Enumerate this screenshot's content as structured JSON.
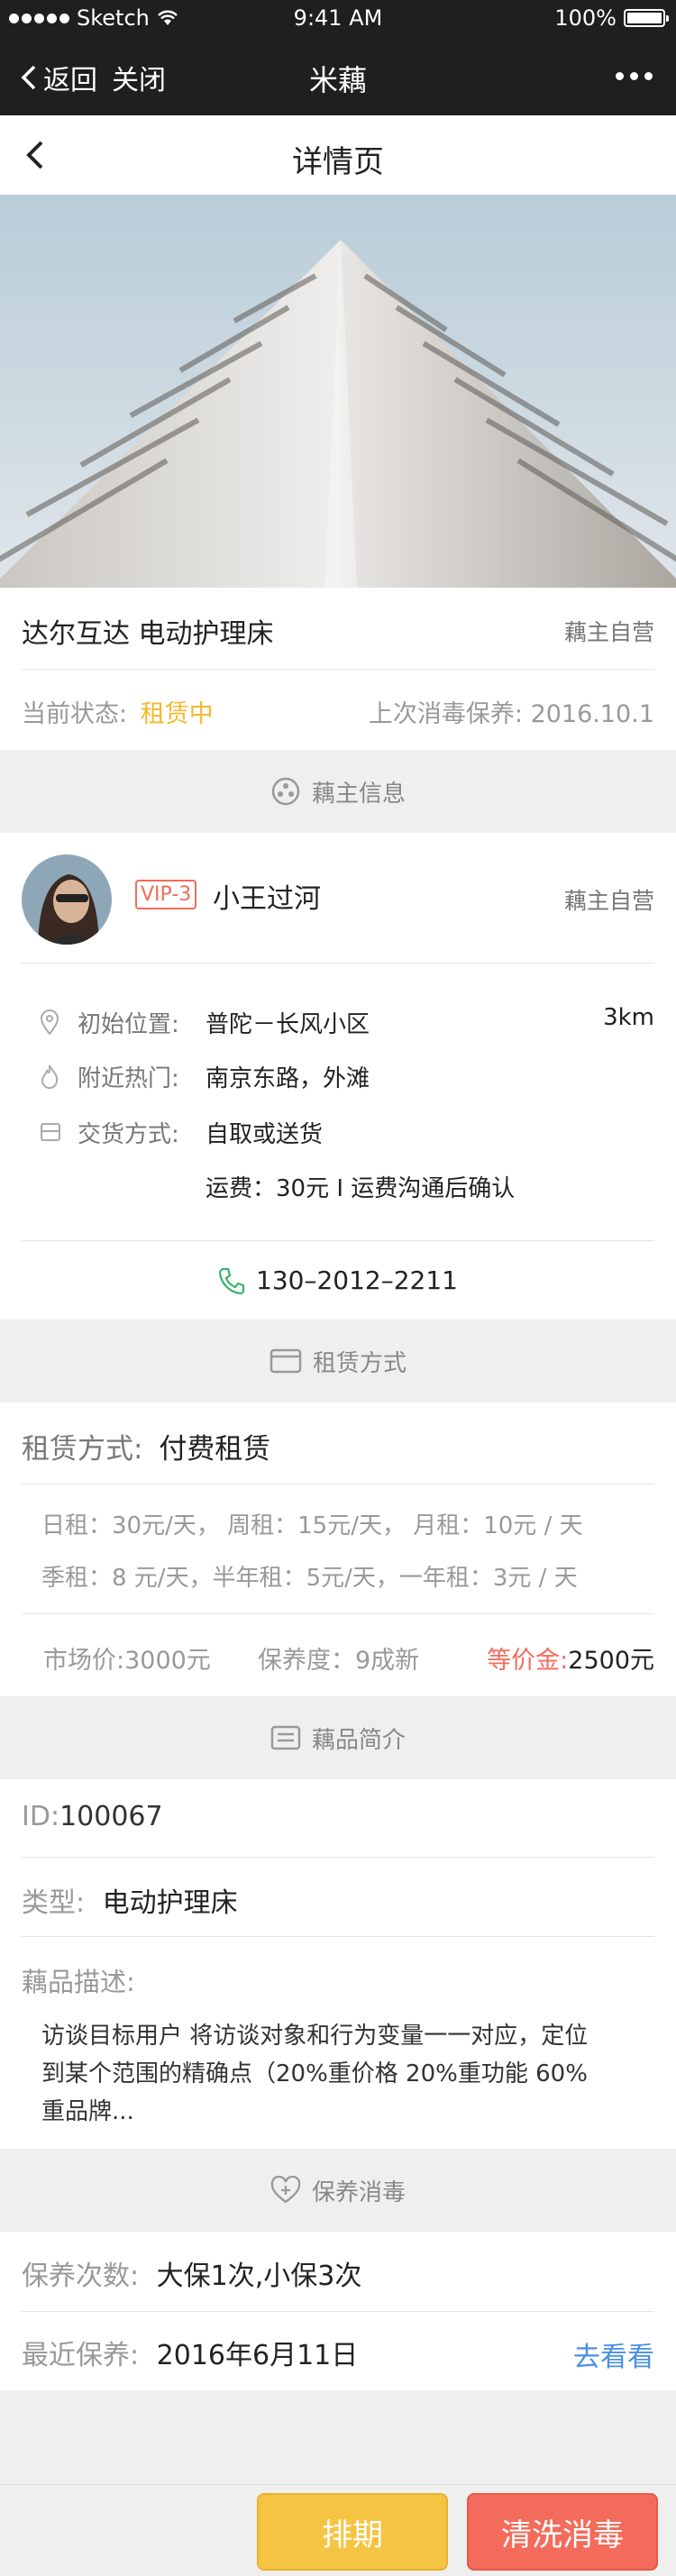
{
  "status_bar": {
    "carrier": "Sketch",
    "time": "9:41 AM",
    "battery": "100%"
  },
  "wx_nav": {
    "back_label": "返回",
    "close_label": "关闭",
    "title": "米藕"
  },
  "page_header": {
    "title": "详情页"
  },
  "product": {
    "name": "达尔互达 电动护理床",
    "owner_type": "藕主自营",
    "status_label": "当前状态:",
    "status_value": "租赁中",
    "last_maintain_label": "上次消毒保养:",
    "last_maintain_value": "2016.10.1"
  },
  "owner_section": {
    "title": "藕主信息"
  },
  "owner": {
    "vip": "VIP-3",
    "name": "小王过河",
    "type": "藕主自营",
    "location_label": "初始位置:",
    "location_value": "普陀－长风小区",
    "distance": "3km",
    "hotspot_label": "附近热门:",
    "hotspot_value": "南京东路，外滩",
    "delivery_label": "交货方式:",
    "delivery_value": "自取或送货",
    "shipping": "运费：30元 I 运费沟通后确认",
    "phone": "130–2012–2211"
  },
  "rent_section": {
    "title": "租赁方式"
  },
  "rent": {
    "mode_label": "租赁方式:",
    "mode_value": "付费租赁",
    "row1": "日租：30元/天，  周租：15元/天，  月租：10元 / 天",
    "row2": "季租：8 元/天，半年租：5元/天，一年租：3元 / 天",
    "market_price": "市场价:3000元",
    "condition": "保养度：9成新",
    "deposit_label": "等价金:",
    "deposit_value": "2500元"
  },
  "intro_section": {
    "title": "藕品简介"
  },
  "intro": {
    "id_label": "ID:",
    "id_value": "100067",
    "type_label": "类型:",
    "type_value": "电动护理床",
    "desc_label": "藕品描述:",
    "desc_line1": "访谈目标用户      将访谈对象和行为变量一一对应，定位",
    "desc_line2": "到某个范围的精确点（20%重价格   20%重功能   60%",
    "desc_line3": "重品牌..."
  },
  "maintain_section": {
    "title": "保养消毒"
  },
  "maintain": {
    "count_label": "保养次数:",
    "count_value": "大保1次,小保3次",
    "recent_label": "最近保养:",
    "recent_value": "2016年6月11日",
    "link": "去看看"
  },
  "actions": {
    "schedule": "排期",
    "clean": "清洗消毒"
  },
  "colors": {
    "accent_yellow": "#f5c443",
    "accent_red": "#f36c5b",
    "link_blue": "#4a90e2",
    "phone_green": "#39b36b"
  }
}
